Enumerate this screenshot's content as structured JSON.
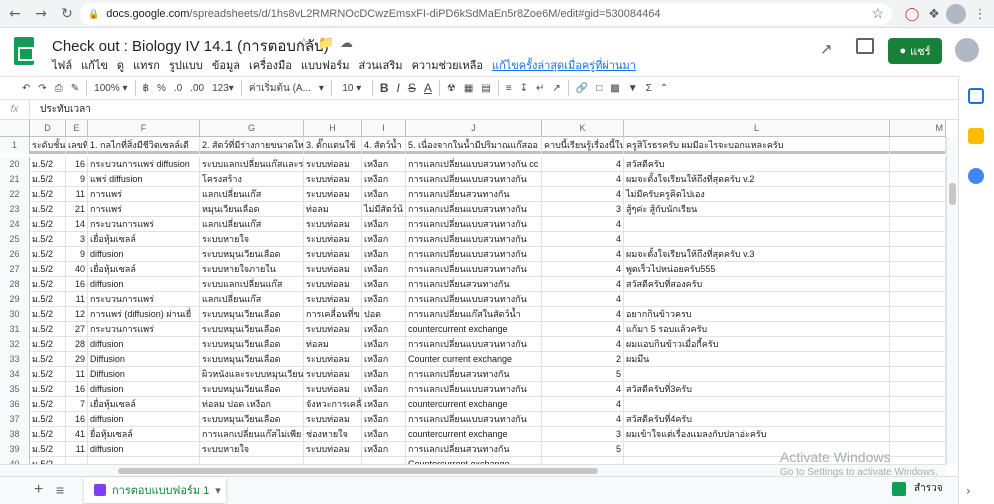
{
  "browser": {
    "url_prefix": "docs.google.com",
    "url_rest": "/spreadsheets/d/1hs8vL2RMRNOcDCwzEmsxFI-diPD6kSdMaEn5r8Zoe6M/edit#gid=530084464",
    "back_icon": "back-arrow",
    "forward_icon": "forward-arrow",
    "reload_icon": "reload"
  },
  "header": {
    "title": "Check out : Biology IV 14.1 (การตอบกลับ)",
    "share_label": "แชร์",
    "menu": [
      "ไฟล์",
      "แก้ไข",
      "ดู",
      "แทรก",
      "รูปแบบ",
      "ข้อมูล",
      "เครื่องมือ",
      "แบบฟอร์ม",
      "ส่วนเสริม",
      "ความช่วยเหลือ"
    ],
    "last_edit": "แก้ไขครั้งล่าสุดเมื่อครู่ที่ผ่านมา"
  },
  "toolbar": {
    "zoom": "100%",
    "currency": "฿",
    "percent": "%",
    "dec_decrease": ".0",
    "dec_increase": ".00",
    "format_more": "123",
    "font": "ค่าเริ่มต้น (A...",
    "font_size": "10",
    "bold": "B",
    "italic": "I",
    "strike": "S",
    "text_color": "A"
  },
  "formula": {
    "fx": "fx",
    "content": "ประทับเวลา"
  },
  "columns": [
    "D",
    "E",
    "F",
    "G",
    "H",
    "I",
    "J",
    "K",
    "L",
    "M"
  ],
  "header_row": {
    "num": "1",
    "cells": [
      "ระดับชั้น",
      "เลขที่",
      "1. กลไกที่สิ่งมีชีวิตเซลล์เดี",
      "2. สัตว์ที่มีร่างกายขนาดให",
      "3. ตั๊กแตนใช้",
      "4. สัตว์น้ำ",
      "5. เนื่องจากในน้ำมีปริมาณแก๊สออ",
      "คาบนี้เรียนรู้เรื่องนี้ใน",
      "ครูสิโรธรครับ ผมมีอะไรจะบอกแหละครับ",
      ""
    ]
  },
  "rows": [
    {
      "n": "20",
      "d": "ม.5/2",
      "e": "16",
      "f": "กระบวนการแพร่ diffusion",
      "g": "ระบบแลกเปลี่ยนแก๊สและร",
      "h": "ระบบท่อลม",
      "i": "เหงือก",
      "j": "การแลกเปลี่ยนแบบสวนทางกัน cc",
      "k": "4",
      "l": "สวัสดีครับ"
    },
    {
      "n": "21",
      "d": "ม.5/2",
      "e": "9",
      "f": "แพร่ diffusion",
      "g": "โครงสร้าง",
      "h": "ระบบท่อลม",
      "i": "เหงือก",
      "j": "การแลกเปลี่ยนแบบสวนทางกัน",
      "k": "4",
      "l": "ผมจะตั้งใจเรียนให้ถึงที่สุดครับ v.2"
    },
    {
      "n": "22",
      "d": "ม.5/2",
      "e": "11",
      "f": "การแพร่",
      "g": "แลกเปลี่ยนแก๊ส",
      "h": "ระบบท่อลม",
      "i": "เหงือก",
      "j": "การแลกเปลี่ยนสวนทางกัน",
      "k": "4",
      "l": "ไม่มีครับครูคิดไปเอง"
    },
    {
      "n": "23",
      "d": "ม.5/2",
      "e": "21",
      "f": "การแพร่",
      "g": "หมุนเวียนเลือด",
      "h": "ท่อลม",
      "i": "ไม่มีสัตว์น้",
      "j": "การแลกเปลี่ยนแบบสวนทางกัน",
      "k": "3",
      "l": "สู้ๆค่ะ สู้กับนักเรียน"
    },
    {
      "n": "24",
      "d": "ม.5/2",
      "e": "14",
      "f": "กระบวนการแพร่",
      "g": "แลกเปลี่ยนแก๊ส",
      "h": "ระบบท่อลม",
      "i": "เหงือก",
      "j": "การแลกเปลี่ยนแบบสวนทางกัน",
      "k": "4",
      "l": ""
    },
    {
      "n": "25",
      "d": "ม.5/2",
      "e": "3",
      "f": "เยื่อหุ้มเซลล์",
      "g": "ระบบหายใจ",
      "h": "ระบบท่อลม",
      "i": "เหงือก",
      "j": "การแลกเปลี่ยนแบบสวนทางกัน",
      "k": "4",
      "l": ""
    },
    {
      "n": "26",
      "d": "ม.5/2",
      "e": "9",
      "f": "diffusion",
      "g": "ระบบหมุนเวียนเลือด",
      "h": "ระบบท่อลม",
      "i": "เหงือก",
      "j": "การแลกเปลี่ยนแบบสวนทางกัน",
      "k": "4",
      "l": "ผมจะตั้งใจเรียนให้ถึงที่สุดครับ v.3"
    },
    {
      "n": "27",
      "d": "ม.5/2",
      "e": "40",
      "f": "เยื่อหุ้มเซลล์",
      "g": "ระบบหายใจภายใน",
      "h": "ระบบท่อลม",
      "i": "เหงือก",
      "j": "การแลกเปลี่ยนแบบสวนทางกัน",
      "k": "4",
      "l": "พูดเร็วไปหน่อยครับ555"
    },
    {
      "n": "28",
      "d": "ม.5/2",
      "e": "16",
      "f": "diffusion",
      "g": "ระบบแลกเปลี่ยนแก๊ส",
      "h": "ระบบท่อลม",
      "i": "เหงือก",
      "j": "การแลกเปลี่ยนสวนทางกัน",
      "k": "4",
      "l": "สวัสดีครับที่สองครับ"
    },
    {
      "n": "29",
      "d": "ม.5/2",
      "e": "11",
      "f": "กระบวนการแพร่",
      "g": "แลกเปลี่ยนแก๊ส",
      "h": "ระบบท่อลม",
      "i": "เหงือก",
      "j": "การแลกเปลี่ยนแบบสวนทางกัน",
      "k": "4",
      "l": ""
    },
    {
      "n": "30",
      "d": "ม.5/2",
      "e": "12",
      "f": "การแพร่ (diffusion) ผ่านเยื่",
      "g": "ระบบหมุนเวียนเลือด",
      "h": "การเคลื่อนที่ข",
      "i": "ปอด",
      "j": "การแลกเปลี่ยนแก๊สในสัตว์น้ำ",
      "k": "4",
      "l": "อยากกินข้าวครบ"
    },
    {
      "n": "31",
      "d": "ม.5/2",
      "e": "27",
      "f": "กระบวนการแพร่",
      "g": "ระบบหมุนเวียนเลือด",
      "h": "ระบบท่อลม",
      "i": "เหงือก",
      "j": "countercurrent exchange",
      "k": "4",
      "l": "แก้มา 5 รอบแล้วครับ"
    },
    {
      "n": "32",
      "d": "ม.5/2",
      "e": "28",
      "f": "diffusion",
      "g": "ระบบหมุนเวียนเลือด",
      "h": "ท่อลม",
      "i": "เหงือก",
      "j": "การแลกเปลี่ยนแบบสวนทางกัน",
      "k": "4",
      "l": "ผมแอบกินข้าวเมื่อกี้ครับ"
    },
    {
      "n": "33",
      "d": "ม.5/2",
      "e": "29",
      "f": "Diffusion",
      "g": "ระบบหมุนเวียนเลือด",
      "h": "ระบบท่อลม",
      "i": "เหงือก",
      "j": "Counter current exchange",
      "k": "2",
      "l": "ผมมึน"
    },
    {
      "n": "34",
      "d": "ม.5/2",
      "e": "11",
      "f": "Diffusion",
      "g": "ผิวหนังและระบบหมุนเวียน",
      "h": "ระบบท่อลม",
      "i": "เหงือก",
      "j": "การแลกเปลี่ยนสวนทางกัน",
      "k": "5",
      "l": ""
    },
    {
      "n": "35",
      "d": "ม.5/2",
      "e": "16",
      "f": "diffusion",
      "g": "ระบบหมุนเวียนเลือด",
      "h": "ระบบท่อลม",
      "i": "เหงือก",
      "j": "การแลกเปลี่ยนแบบสวนทางกัน",
      "k": "4",
      "l": "สวัสดีครับที่3ครับ"
    },
    {
      "n": "36",
      "d": "ม.5/2",
      "e": "7",
      "f": "เยื่อหุ้มเซลล์",
      "g": "ท่อลม ปอด เหงือก",
      "h": "จังหวะการเคลื่",
      "i": "เหงือก",
      "j": "countercurrent exchange",
      "k": "4",
      "l": ""
    },
    {
      "n": "37",
      "d": "ม.5/2",
      "e": "16",
      "f": "diffusion",
      "g": "ระบบหมุนเวียนเลือด",
      "h": "ระบบท่อลม",
      "i": "เหงือก",
      "j": "การแลกเปลี่ยนแบบสวนทางกัน",
      "k": "4",
      "l": "สวัสดีครับที่4ครับ"
    },
    {
      "n": "38",
      "d": "ม.5/2",
      "e": "41",
      "f": "ยื่อหุ้มเซลล์",
      "g": "การแลกเปลี่ยนแก๊สไม่เพีย",
      "h": "ช่องหายใจ",
      "i": "เหงือก",
      "j": "countercurrent exchange",
      "k": "3",
      "l": "ผมเข้าใจแต่เรื่องแมลงกับปลาอ่ะครับ"
    },
    {
      "n": "39",
      "d": "ม.5/2",
      "e": "11",
      "f": "diffusion",
      "g": "ระบบหายใจ",
      "h": "ระบบท่อลม",
      "i": "เหงือก",
      "j": "การแลกเปลี่ยนสวนทางกัน",
      "k": "5",
      "l": ""
    },
    {
      "n": "40",
      "d": "ม.5/2",
      "e": "",
      "f": "",
      "g": "",
      "h": "",
      "i": "",
      "j": "Countercurrent exchange",
      "k": "",
      "l": ""
    }
  ],
  "sheets": {
    "active_tab": "การตอบแบบฟอร์ม 1",
    "explore": "สำรวจ"
  },
  "watermark": {
    "line1": "Activate Windows",
    "line2": "Go to Settings to activate Windows."
  }
}
